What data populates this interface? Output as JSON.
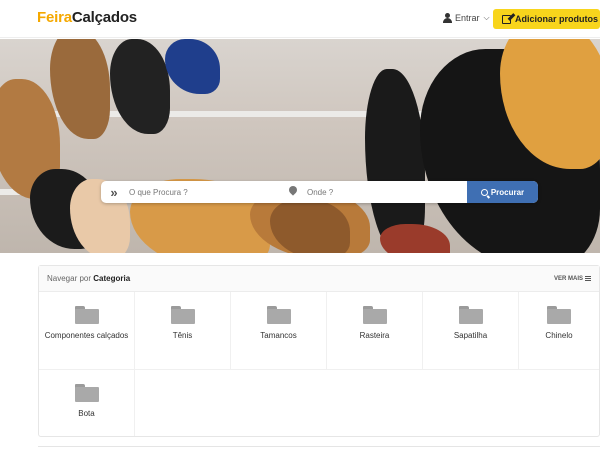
{
  "header": {
    "logo_part1": "Feira",
    "logo_part2": "Calçados",
    "login_label": "Entrar",
    "add_button_label": "Adicionar produtos"
  },
  "search": {
    "what_placeholder": "O que Procura ?",
    "where_placeholder": "Onde ?",
    "button_label": "Procurar"
  },
  "categories": {
    "title_prefix": "Navegar por",
    "title_strong": "Categoria",
    "see_more_label": "VER MAIS",
    "items": [
      {
        "label": "Componentes calçados"
      },
      {
        "label": "Tênis"
      },
      {
        "label": "Tamancos"
      },
      {
        "label": "Rasteira"
      },
      {
        "label": "Sapatilha"
      },
      {
        "label": "Chinelo"
      },
      {
        "label": "Bota"
      }
    ]
  },
  "icons": {
    "user": "user-icon",
    "chevron": "chevron-down-icon",
    "edit": "edit-icon",
    "arrows": "double-chevron-right-icon",
    "location": "map-pin-icon",
    "search": "search-icon",
    "folder": "folder-icon",
    "list": "list-icon"
  },
  "colors": {
    "accent": "#f5a800",
    "add_button": "#f8d51c",
    "search_button": "#3f6fb3"
  }
}
